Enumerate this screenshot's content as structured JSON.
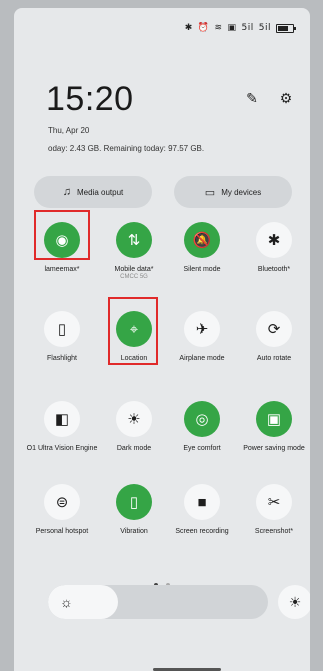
{
  "status_bar": {
    "icons": [
      "nfc-icon",
      "alarm-icon",
      "wifi-icon",
      "data-icon",
      "signal-1-icon",
      "signal-2-icon",
      "battery-icon"
    ],
    "signal_1": "5il",
    "signal_2": "5il"
  },
  "header": {
    "time": "15:20",
    "date": "Thu, Apr 20",
    "usage": "oday: 2.43 GB. Remaining today: 97.57 GB.",
    "edit_icon": "edit-icon",
    "settings_icon": "gear-icon"
  },
  "quick_actions": {
    "media_output": "Media output",
    "my_devices": "My devices"
  },
  "tiles": [
    {
      "id": "wifi",
      "label": "lameemax*",
      "sub": "",
      "on": true,
      "icon": "wifi-icon",
      "glyph": "◉"
    },
    {
      "id": "mobile-data",
      "label": "Mobile data*",
      "sub": "CMCC 5G",
      "on": true,
      "icon": "mobile-data-icon",
      "glyph": "⇅"
    },
    {
      "id": "silent-mode",
      "label": "Silent mode",
      "sub": "",
      "on": true,
      "icon": "bell-off-icon",
      "glyph": "🔕"
    },
    {
      "id": "bluetooth",
      "label": "Bluetooth*",
      "sub": "",
      "on": false,
      "icon": "bluetooth-icon",
      "glyph": "✱"
    },
    {
      "id": "flashlight",
      "label": "Flashlight",
      "sub": "",
      "on": false,
      "icon": "flashlight-icon",
      "glyph": "▯"
    },
    {
      "id": "location",
      "label": "Location",
      "sub": "",
      "on": true,
      "icon": "location-icon",
      "glyph": "⌖"
    },
    {
      "id": "airplane",
      "label": "Airplane mode",
      "sub": "",
      "on": false,
      "icon": "airplane-icon",
      "glyph": "✈"
    },
    {
      "id": "auto-rotate",
      "label": "Auto rotate",
      "sub": "",
      "on": false,
      "icon": "rotate-icon",
      "glyph": "⟳"
    },
    {
      "id": "ultra-vision",
      "label": "O1 Ultra Vision Engine",
      "sub": "",
      "on": false,
      "icon": "vision-engine-icon",
      "glyph": "◧"
    },
    {
      "id": "dark-mode",
      "label": "Dark mode",
      "sub": "",
      "on": false,
      "icon": "dark-mode-icon",
      "glyph": "☀"
    },
    {
      "id": "eye-comfort",
      "label": "Eye comfort",
      "sub": "",
      "on": true,
      "icon": "eye-icon",
      "glyph": "◎"
    },
    {
      "id": "power-saving",
      "label": "Power saving mode",
      "sub": "",
      "on": true,
      "icon": "battery-saver-icon",
      "glyph": "▣"
    },
    {
      "id": "hotspot",
      "label": "Personal hotspot",
      "sub": "",
      "on": false,
      "icon": "hotspot-icon",
      "glyph": "⊜"
    },
    {
      "id": "vibration",
      "label": "Vibration",
      "sub": "",
      "on": true,
      "icon": "vibration-icon",
      "glyph": "▯"
    },
    {
      "id": "screen-recording",
      "label": "Screen recording",
      "sub": "",
      "on": false,
      "icon": "video-camera-icon",
      "glyph": "■"
    },
    {
      "id": "screenshot",
      "label": "Screenshot*",
      "sub": "",
      "on": false,
      "icon": "screenshot-icon",
      "glyph": "✂"
    }
  ],
  "brightness": {
    "level": 0.32,
    "icon": "sun-icon",
    "auto_icon": "auto-brightness-icon"
  },
  "pager": {
    "pages": 2,
    "active": 0
  },
  "colors": {
    "tile_on": "#35a546",
    "tile_off": "#f6f7f8",
    "highlight": "#e02a2a",
    "panel": "#e6e8ea"
  },
  "highlights": [
    "wifi",
    "location"
  ]
}
